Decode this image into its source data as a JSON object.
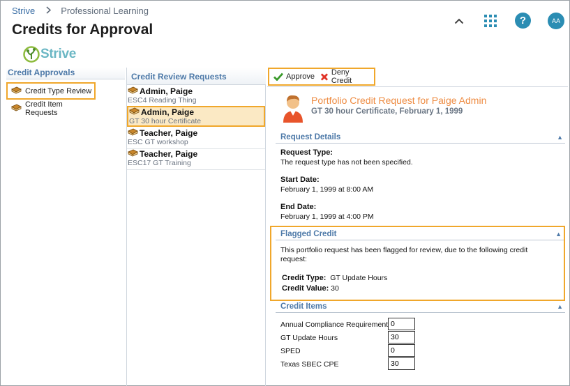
{
  "breadcrumb": {
    "root": "Strive",
    "current": "Professional Learning"
  },
  "page_title": "Credits for Approval",
  "header_icons": [
    "chevron-up-icon",
    "apps-grid-icon",
    "help-icon",
    "avatar"
  ],
  "user": {
    "initials": "AA"
  },
  "logo": {
    "text": "Strive"
  },
  "left_pane": {
    "title": "Credit Approvals",
    "items": [
      {
        "label": "Credit Type Review",
        "highlighted": true
      },
      {
        "label": "Credit Item Requests",
        "highlighted": false
      }
    ]
  },
  "mid_pane": {
    "title": "Credit Review Requests",
    "requests": [
      {
        "name": "Admin, Paige",
        "detail": "ESC4 Reading Thing",
        "selected": false
      },
      {
        "name": "Admin, Paige",
        "detail": "GT 30 hour Certificate",
        "selected": true
      },
      {
        "name": "Teacher, Paige",
        "detail": "ESC GT workshop",
        "selected": false
      },
      {
        "name": "Teacher, Paige",
        "detail": "ESC17 GT Training",
        "selected": false
      }
    ]
  },
  "toolbar": {
    "approve_label": "Approve",
    "deny_label": "Deny Credit"
  },
  "request": {
    "title": "Portfolio Credit Request for Paige Admin",
    "subtitle": "GT 30 hour Certificate, February 1, 1999"
  },
  "request_details": {
    "heading": "Request Details",
    "type_label": "Request Type:",
    "type_value": "The request type has not been specified.",
    "start_label": "Start Date:",
    "start_value": "February 1, 1999 at 8:00 AM",
    "end_label": "End Date:",
    "end_value": "February 1, 1999 at 4:00 PM"
  },
  "flagged": {
    "heading": "Flagged Credit",
    "text": "This portfolio request has been flagged for review, due to the following credit request:",
    "credit_type_label": "Credit Type:",
    "credit_type_value": "GT Update Hours",
    "credit_value_label": "Credit Value:",
    "credit_value_value": "30"
  },
  "credit_items": {
    "heading": "Credit Items",
    "items": [
      {
        "label": "Annual Compliance Requirement",
        "value": "0"
      },
      {
        "label": "GT Update Hours",
        "value": "30"
      },
      {
        "label": "SPED",
        "value": "0"
      },
      {
        "label": "Texas SBEC CPE",
        "value": "30"
      }
    ]
  },
  "colors": {
    "accent_highlight": "#f0a72b",
    "link_blue": "#4d79a8",
    "title_orange": "#ee8c43",
    "brand_teal": "#2b8db3"
  }
}
